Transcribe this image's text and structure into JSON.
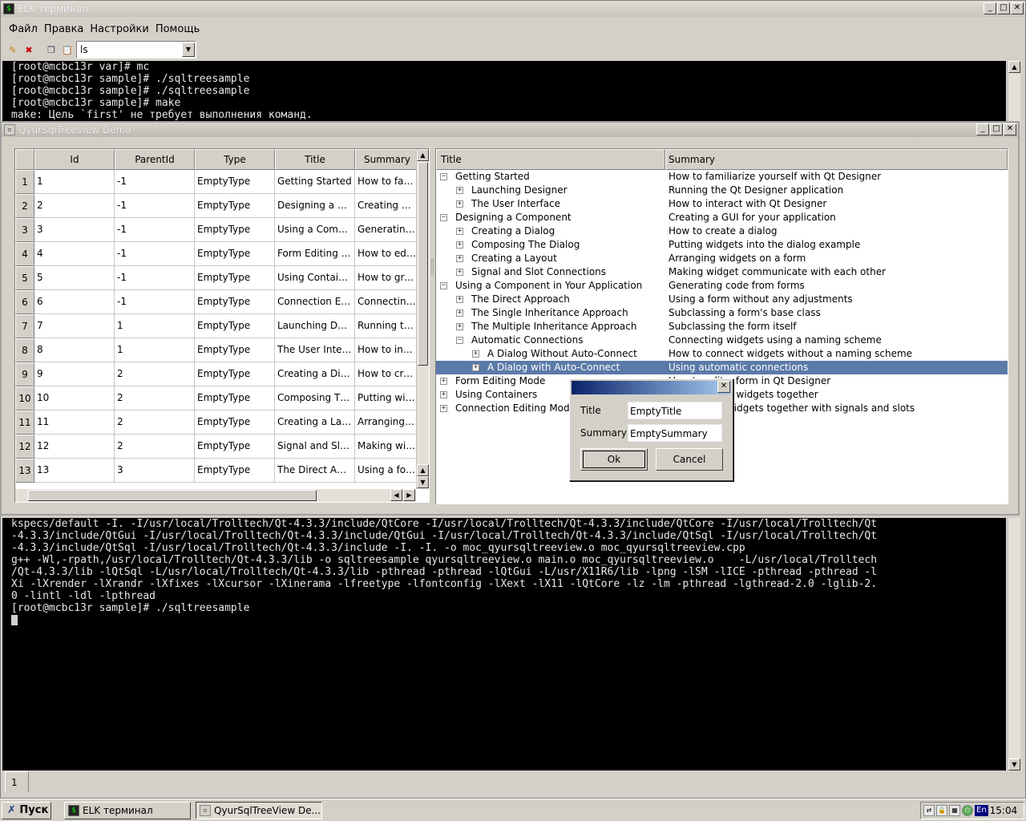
{
  "elk": {
    "title": "ELK терминал",
    "menu": [
      "Файл",
      "Правка",
      "Настройки",
      "Помощь"
    ],
    "command_combo": "ls",
    "terminal_top": [
      "[root@mcbc13r var]# mc",
      "[root@mcbc13r sample]# ./sqltreesample",
      "[root@mcbc13r sample]# ./sqltreesample",
      "[root@mcbc13r sample]# make",
      "make: Цель `first' не требует выполнения команд."
    ],
    "terminal_bottom": [
      "kspecs/default -I. -I/usr/local/Trolltech/Qt-4.3.3/include/QtCore -I/usr/local/Trolltech/Qt-4.3.3/include/QtCore -I/usr/local/Trolltech/Qt",
      "-4.3.3/include/QtGui -I/usr/local/Trolltech/Qt-4.3.3/include/QtGui -I/usr/local/Trolltech/Qt-4.3.3/include/QtSql -I/usr/local/Trolltech/Qt",
      "-4.3.3/include/QtSql -I/usr/local/Trolltech/Qt-4.3.3/include -I. -I. -o moc_qyursqltreeview.o moc_qyursqltreeview.cpp",
      "g++ -Wl,-rpath,/usr/local/Trolltech/Qt-4.3.3/lib -o sqltreesample qyursqltreeview.o main.o moc_qyursqltreeview.o    -L/usr/local/Trolltech",
      "/Qt-4.3.3/lib -lQtSql -L/usr/local/Trolltech/Qt-4.3.3/lib -pthread -pthread -lQtGui -L/usr/X11R6/lib -lpng -lSM -lICE -pthread -pthread -l",
      "Xi -lXrender -lXrandr -lXfixes -lXcursor -lXinerama -lfreetype -lfontconfig -lXext -lX11 -lQtCore -lz -lm -pthread -lgthread-2.0 -lglib-2.",
      "0 -lintl -ldl -lpthread",
      "[root@mcbc13r sample]# ./sqltreesample"
    ],
    "tab_label": "1"
  },
  "demo": {
    "title": "QyurSqlTreeView Demo",
    "table": {
      "columns": [
        "Id",
        "ParentId",
        "Type",
        "Title",
        "Summary"
      ],
      "rows": [
        {
          "n": "1",
          "id": "1",
          "parent": "-1",
          "type": "EmptyType",
          "title": "Getting Started",
          "summary": "How to familia"
        },
        {
          "n": "2",
          "id": "2",
          "parent": "-1",
          "type": "EmptyType",
          "title": "Designing a C…",
          "summary": "Creating a GU"
        },
        {
          "n": "3",
          "id": "3",
          "parent": "-1",
          "type": "EmptyType",
          "title": "Using a Comp…",
          "summary": "Generating co"
        },
        {
          "n": "4",
          "id": "4",
          "parent": "-1",
          "type": "EmptyType",
          "title": "Form Editing …",
          "summary": "How to edit a"
        },
        {
          "n": "5",
          "id": "5",
          "parent": "-1",
          "type": "EmptyType",
          "title": "Using Contain…",
          "summary": "How to group"
        },
        {
          "n": "6",
          "id": "6",
          "parent": "-1",
          "type": "EmptyType",
          "title": "Connection E…",
          "summary": "Connecting w"
        },
        {
          "n": "7",
          "id": "7",
          "parent": "1",
          "type": "EmptyType",
          "title": "Launching De…",
          "summary": "Running the Q"
        },
        {
          "n": "8",
          "id": "8",
          "parent": "1",
          "type": "EmptyType",
          "title": "The User Interf…",
          "summary": "How to intera"
        },
        {
          "n": "9",
          "id": "9",
          "parent": "2",
          "type": "EmptyType",
          "title": "Creating a Dia…",
          "summary": "How to create"
        },
        {
          "n": "10",
          "id": "10",
          "parent": "2",
          "type": "EmptyType",
          "title": "Composing Th…",
          "summary": "Putting widge"
        },
        {
          "n": "11",
          "id": "11",
          "parent": "2",
          "type": "EmptyType",
          "title": "Creating a Lay…",
          "summary": "Arranging wid"
        },
        {
          "n": "12",
          "id": "12",
          "parent": "2",
          "type": "EmptyType",
          "title": "Signal and Slo…",
          "summary": "Making widge"
        },
        {
          "n": "13",
          "id": "13",
          "parent": "3",
          "type": "EmptyType",
          "title": "The Direct Ap…",
          "summary": "Using a form"
        }
      ]
    },
    "tree": {
      "columns": [
        "Title",
        "Summary"
      ],
      "nodes": [
        {
          "level": 0,
          "state": "-",
          "title": "Getting Started",
          "summary": "How to familiarize yourself with Qt Designer"
        },
        {
          "level": 1,
          "state": "+",
          "title": "Launching Designer",
          "summary": "Running the Qt Designer application"
        },
        {
          "level": 1,
          "state": "+",
          "title": "The User Interface",
          "summary": "How to interact with Qt Designer"
        },
        {
          "level": 0,
          "state": "-",
          "title": "Designing a Component",
          "summary": "Creating a GUI for your application"
        },
        {
          "level": 1,
          "state": "+",
          "title": "Creating a Dialog",
          "summary": "How to create a dialog"
        },
        {
          "level": 1,
          "state": "+",
          "title": "Composing The Dialog",
          "summary": "Putting widgets into the dialog example"
        },
        {
          "level": 1,
          "state": "+",
          "title": "Creating a Layout",
          "summary": "Arranging widgets on a form"
        },
        {
          "level": 1,
          "state": "+",
          "title": "Signal and Slot Connections",
          "summary": "Making widget communicate with each other"
        },
        {
          "level": 0,
          "state": "-",
          "title": "Using a Component in Your Application",
          "summary": "Generating code from forms"
        },
        {
          "level": 1,
          "state": "+",
          "title": "The Direct Approach",
          "summary": "Using a form without any adjustments"
        },
        {
          "level": 1,
          "state": "+",
          "title": "The Single Inheritance Approach",
          "summary": "Subclassing a form's base class"
        },
        {
          "level": 1,
          "state": "+",
          "title": "The Multiple Inheritance Approach",
          "summary": "Subclassing the form itself"
        },
        {
          "level": 1,
          "state": "-",
          "title": "Automatic Connections",
          "summary": "Connecting widgets using a naming scheme"
        },
        {
          "level": 2,
          "state": "+",
          "title": "A Dialog Without Auto-Connect",
          "summary": "How to connect widgets without a naming scheme"
        },
        {
          "level": 2,
          "state": "+",
          "title": "A Dialog with Auto-Connect",
          "summary": "Using automatic connections",
          "selected": true
        },
        {
          "level": 0,
          "state": "+",
          "title": "Form Editing Mode",
          "summary": "How to edit a form in Qt Designer"
        },
        {
          "level": 0,
          "state": "+",
          "title": "Using Containers",
          "summary": "How to group widgets together"
        },
        {
          "level": 0,
          "state": "+",
          "title": "Connection Editing Mode",
          "summary": "Connecting widgets together with signals and slots"
        }
      ]
    },
    "dialog": {
      "title_label": "Title",
      "title_value": "EmptyTitle",
      "summary_label": "Summary",
      "summary_value": "EmptySummary",
      "ok": "Ok",
      "cancel": "Cancel"
    }
  },
  "taskbar": {
    "start": "Пуск",
    "tasks": [
      "ELK терминал",
      "QyurSqlTreeView De..."
    ],
    "lang": "En",
    "clock": "15:04"
  },
  "colors": {
    "selection": "#5b7aa8",
    "terminal_bg": "#000000",
    "dialog_title": "#0a246a"
  }
}
